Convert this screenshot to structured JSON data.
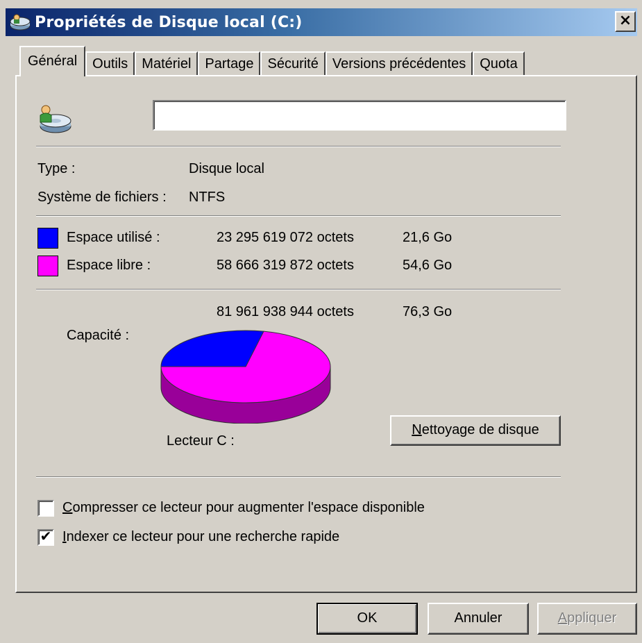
{
  "window": {
    "title": "Propriétés de Disque local (C:)",
    "close_label": "×"
  },
  "tabs": [
    {
      "label": "Général",
      "active": true
    },
    {
      "label": "Outils",
      "active": false
    },
    {
      "label": "Matériel",
      "active": false
    },
    {
      "label": "Partage",
      "active": false
    },
    {
      "label": "Sécurité",
      "active": false
    },
    {
      "label": "Versions précédentes",
      "active": false
    },
    {
      "label": "Quota",
      "active": false
    }
  ],
  "general": {
    "volume_name": "",
    "type_label": "Type :",
    "type_value": "Disque local",
    "fs_label": "Système de fichiers :",
    "fs_value": "NTFS",
    "used_label": "Espace utilisé :",
    "used_bytes": "23 295 619 072 octets",
    "used_size": "21,6 Go",
    "free_label": "Espace libre :",
    "free_bytes": "58 666 319 872 octets",
    "free_size": "54,6 Go",
    "capacity_label": "Capacité :",
    "capacity_bytes": "81 961 938 944 octets",
    "capacity_size": "76,3 Go",
    "drive_label": "Lecteur C :",
    "cleanup_button_prefix": "",
    "cleanup_button_underlined": "N",
    "cleanup_button_rest": "ettoyage de disque",
    "compress_underlined": "C",
    "compress_rest": "ompresser ce lecteur pour augmenter l'espace disponible",
    "compress_checked": false,
    "index_underlined": "I",
    "index_rest": "ndexer ce lecteur pour une recherche rapide",
    "index_checked": true,
    "used_fraction": 0.284,
    "colors": {
      "used": "#0000ff",
      "free": "#ff00ff",
      "free_side": "#990099",
      "used_side": "#000099"
    }
  },
  "footer": {
    "ok_label": "OK",
    "cancel_label": "Annuler",
    "apply_underlined": "A",
    "apply_rest": "ppliquer"
  },
  "icons": [
    "drive-icon",
    "close-icon",
    "check-icon"
  ]
}
